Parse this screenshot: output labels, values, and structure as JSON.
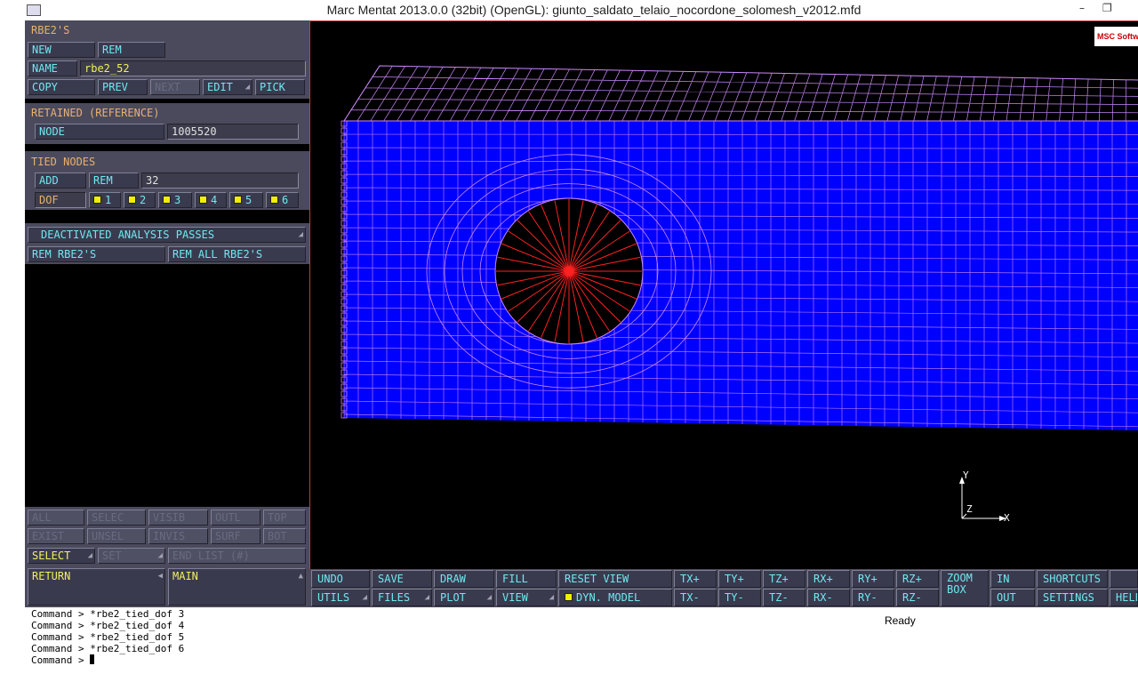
{
  "window": {
    "title": "Marc Mentat 2013.0.0 (32bit) (OpenGL): giunto_saldato_telaio_nocordone_solomesh_v2012.mfd",
    "minimize": "–",
    "restore": "❐"
  },
  "rbe2": {
    "heading": "RBE2'S",
    "new_label": "NEW",
    "rem_label": "REM",
    "name_label": "NAME",
    "name_value": "rbe2_52",
    "copy_label": "COPY",
    "prev_label": "PREV",
    "next_label": "NEXT",
    "edit_label": "EDIT",
    "pick_label": "PICK"
  },
  "retained": {
    "heading": "RETAINED (REFERENCE)",
    "node_label": "NODE",
    "node_value": "1005520"
  },
  "tied": {
    "heading": "TIED NODES",
    "add_label": "ADD",
    "rem_label": "REM",
    "count": "32",
    "dof_label": "DOF",
    "dofs": [
      "1",
      "2",
      "3",
      "4",
      "5",
      "6"
    ]
  },
  "deactivated": {
    "label": "DEACTIVATED ANALYSIS PASSES"
  },
  "rem_rbe2_label": "REM RBE2'S",
  "rem_all_label": "REM ALL RBE2'S",
  "select_grid": {
    "row1": [
      "ALL",
      "SELEC",
      "VISIB",
      "OUTL",
      "TOP"
    ],
    "row2": [
      "EXIST",
      "UNSEL",
      "INVIS",
      "SURF",
      "BOT"
    ],
    "select_label": "SELECT",
    "set_label": "SET",
    "end_list_label": "END LIST (#)"
  },
  "nav": {
    "return_label": "RETURN",
    "main_label": "MAIN"
  },
  "toolbar": {
    "undo": "UNDO",
    "save": "SAVE",
    "draw": "DRAW",
    "fill": "FILL",
    "reset_view": "RESET VIEW",
    "tx_plus": "TX+",
    "ty_plus": "TY+",
    "tz_plus": "TZ+",
    "rx_plus": "RX+",
    "ry_plus": "RY+",
    "rz_plus": "RZ+",
    "zoom_box": "ZOOM BOX",
    "in": "IN",
    "shortcuts": "SHORTCUTS",
    "utils": "UTILS",
    "files": "FILES",
    "plot": "PLOT",
    "view": "VIEW",
    "dyn_model": "DYN. MODEL",
    "tx_minus": "TX-",
    "ty_minus": "TY-",
    "tz_minus": "TZ-",
    "rx_minus": "RX-",
    "ry_minus": "RY-",
    "rz_minus": "RZ-",
    "out": "OUT",
    "settings": "SETTINGS",
    "help": "HELP"
  },
  "viewport": {
    "logo_text": "MSC Softw",
    "axis_y": "Y",
    "axis_z": "Z",
    "axis_x": "X",
    "mesh_color": "#0000ff",
    "edge_color": "#cc88ff",
    "rbe_color": "#ff2020"
  },
  "console": {
    "lines": [
      "Command > *rbe2_tied_dof 3",
      "Command > *rbe2_tied_dof 4",
      "Command > *rbe2_tied_dof 5",
      "Command > *rbe2_tied_dof 6",
      "Command > "
    ],
    "status": "Ready"
  }
}
